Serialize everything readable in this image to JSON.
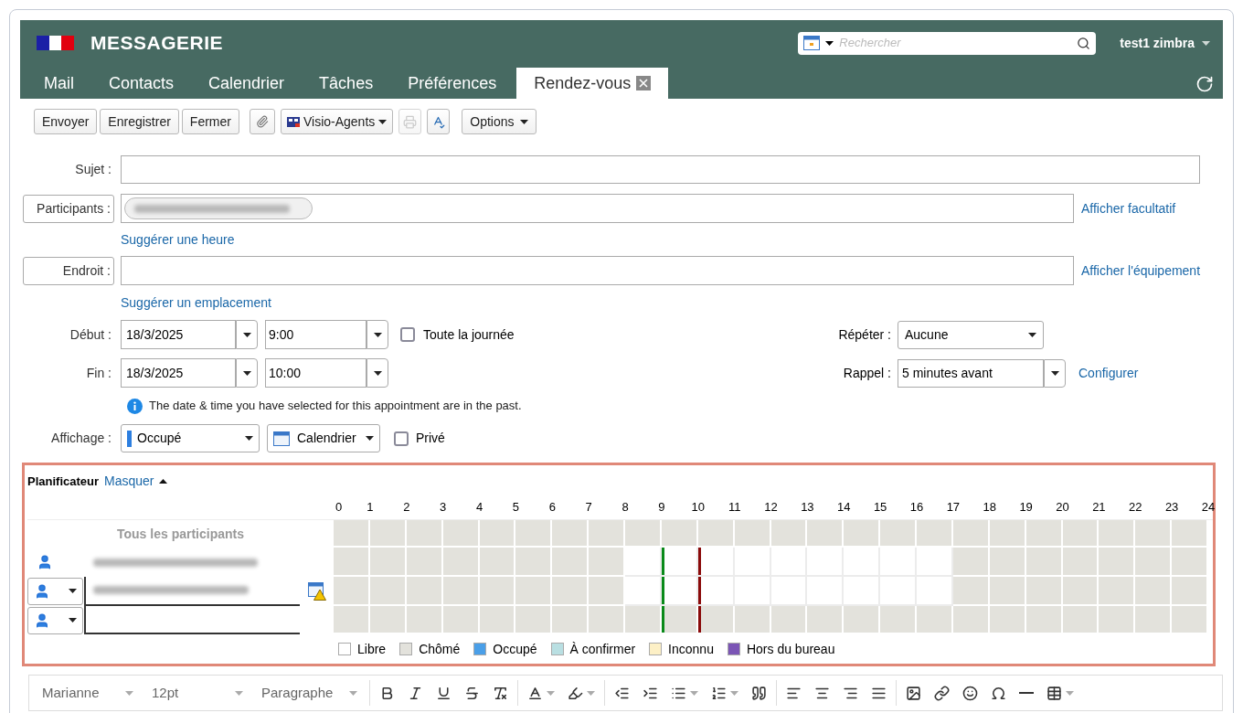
{
  "header": {
    "title": "MESSAGERIE",
    "search": {
      "placeholder": "Rechercher"
    },
    "user": "test1 zimbra"
  },
  "tabs": [
    {
      "label": "Mail",
      "selected": false
    },
    {
      "label": "Contacts",
      "selected": false
    },
    {
      "label": "Calendrier",
      "selected": false
    },
    {
      "label": "Tâches",
      "selected": false
    },
    {
      "label": "Préférences",
      "selected": false
    },
    {
      "label": "Rendez-vous",
      "selected": true
    }
  ],
  "toolbar": [
    {
      "kind": "button",
      "label": "Envoyer",
      "disabled": false
    },
    {
      "kind": "button",
      "label": "Enregistrer",
      "disabled": false
    },
    {
      "kind": "button",
      "label": "Fermer",
      "disabled": false
    },
    {
      "kind": "attach",
      "disabled": false
    },
    {
      "kind": "visio",
      "label": "Visio-Agents",
      "disabled": false
    },
    {
      "kind": "print",
      "disabled": true
    },
    {
      "kind": "spell",
      "disabled": false
    },
    {
      "kind": "menu",
      "label": "Options",
      "disabled": false
    }
  ],
  "form": {
    "subject": {
      "label": "Sujet :"
    },
    "participants": {
      "label": "Participants :",
      "link": "Afficher facultatif",
      "suggest": "Suggérer une heure"
    },
    "location": {
      "label": "Endroit :",
      "link": "Afficher l'équipement",
      "suggest": "Suggérer un emplacement"
    },
    "start": {
      "label": "Début :",
      "date": "18/3/2025",
      "time": "9:00"
    },
    "all_day": {
      "label": "Toute la journée",
      "checked": false
    },
    "end": {
      "label": "Fin :",
      "date": "18/3/2025",
      "time": "10:00"
    },
    "repeat": {
      "label": "Répéter :",
      "value": "Aucune"
    },
    "reminder": {
      "label": "Rappel :",
      "value": "5 minutes avant",
      "link": "Configurer"
    },
    "notice": "The date & time you have selected for this appointment are in the past.",
    "display": {
      "label": "Affichage :",
      "status": "Occupé",
      "calendar": "Calendrier"
    },
    "private": {
      "label": "Privé",
      "checked": false
    }
  },
  "scheduler": {
    "title": "Planificateur",
    "toggle": "Masquer",
    "all_label": "Tous les participants",
    "hours": [
      {
        "label": "0",
        "start_line": false,
        "end_line": false
      },
      {
        "label": "1",
        "start_line": false,
        "end_line": false
      },
      {
        "label": "2",
        "start_line": false,
        "end_line": false
      },
      {
        "label": "3",
        "start_line": false,
        "end_line": false
      },
      {
        "label": "4",
        "start_line": false,
        "end_line": false
      },
      {
        "label": "5",
        "start_line": false,
        "end_line": false
      },
      {
        "label": "6",
        "start_line": false,
        "end_line": false
      },
      {
        "label": "7",
        "start_line": false,
        "end_line": false
      },
      {
        "label": "8",
        "start_line": false,
        "end_line": false
      },
      {
        "label": "9",
        "start_line": true,
        "end_line": false
      },
      {
        "label": "10",
        "start_line": false,
        "end_line": true
      },
      {
        "label": "11",
        "start_line": false,
        "end_line": false
      },
      {
        "label": "12",
        "start_line": false,
        "end_line": false
      },
      {
        "label": "13",
        "start_line": false,
        "end_line": false
      },
      {
        "label": "14",
        "start_line": false,
        "end_line": false
      },
      {
        "label": "15",
        "start_line": false,
        "end_line": false
      },
      {
        "label": "16",
        "start_line": false,
        "end_line": false
      },
      {
        "label": "17",
        "start_line": false,
        "end_line": false
      },
      {
        "label": "18",
        "start_line": false,
        "end_line": false
      },
      {
        "label": "19",
        "start_line": false,
        "end_line": false
      },
      {
        "label": "20",
        "start_line": false,
        "end_line": false
      },
      {
        "label": "21",
        "start_line": false,
        "end_line": false
      },
      {
        "label": "22",
        "start_line": false,
        "end_line": false
      },
      {
        "label": "23",
        "start_line": false,
        "end_line": false
      },
      {
        "label": "24",
        "start_line": false,
        "end_line": false
      }
    ],
    "all_slots": [
      {
        "free": false
      },
      {
        "free": false
      },
      {
        "free": false
      },
      {
        "free": false
      },
      {
        "free": false
      },
      {
        "free": false
      },
      {
        "free": false
      },
      {
        "free": false
      },
      {
        "free": false
      },
      {
        "free": false
      },
      {
        "free": false
      },
      {
        "free": false
      },
      {
        "free": false
      },
      {
        "free": false
      },
      {
        "free": false
      },
      {
        "free": false
      },
      {
        "free": false
      },
      {
        "free": false
      },
      {
        "free": false
      },
      {
        "free": false
      },
      {
        "free": false
      },
      {
        "free": false
      },
      {
        "free": false
      },
      {
        "free": false
      }
    ],
    "rows": [
      {
        "kind": "organizer",
        "warning": false,
        "slots": [
          {
            "free": false
          },
          {
            "free": false
          },
          {
            "free": false
          },
          {
            "free": false
          },
          {
            "free": false
          },
          {
            "free": false
          },
          {
            "free": false
          },
          {
            "free": false
          },
          {
            "free": true
          },
          {
            "free": true
          },
          {
            "free": true
          },
          {
            "free": true
          },
          {
            "free": true
          },
          {
            "free": true
          },
          {
            "free": true
          },
          {
            "free": true
          },
          {
            "free": true
          },
          {
            "free": false
          },
          {
            "free": false
          },
          {
            "free": false
          },
          {
            "free": false
          },
          {
            "free": false
          },
          {
            "free": false
          },
          {
            "free": false
          }
        ]
      },
      {
        "kind": "attendee",
        "warning": true,
        "slots": [
          {
            "free": false
          },
          {
            "free": false
          },
          {
            "free": false
          },
          {
            "free": false
          },
          {
            "free": false
          },
          {
            "free": false
          },
          {
            "free": false
          },
          {
            "free": false
          },
          {
            "free": true
          },
          {
            "free": true
          },
          {
            "free": true
          },
          {
            "free": true
          },
          {
            "free": true
          },
          {
            "free": true
          },
          {
            "free": true
          },
          {
            "free": true
          },
          {
            "free": true
          },
          {
            "free": false
          },
          {
            "free": false
          },
          {
            "free": false
          },
          {
            "free": false
          },
          {
            "free": false
          },
          {
            "free": false
          },
          {
            "free": false
          }
        ]
      },
      {
        "kind": "empty",
        "warning": false,
        "slots": [
          {
            "free": false
          },
          {
            "free": false
          },
          {
            "free": false
          },
          {
            "free": false
          },
          {
            "free": false
          },
          {
            "free": false
          },
          {
            "free": false
          },
          {
            "free": false
          },
          {
            "free": false
          },
          {
            "free": false
          },
          {
            "free": false
          },
          {
            "free": false
          },
          {
            "free": false
          },
          {
            "free": false
          },
          {
            "free": false
          },
          {
            "free": false
          },
          {
            "free": false
          },
          {
            "free": false
          },
          {
            "free": false
          },
          {
            "free": false
          },
          {
            "free": false
          },
          {
            "free": false
          },
          {
            "free": false
          },
          {
            "free": false
          }
        ]
      }
    ],
    "legend": [
      {
        "label": "Libre",
        "color": "#ffffff"
      },
      {
        "label": "Chômé",
        "color": "#e3e2dc"
      },
      {
        "label": "Occupé",
        "color": "#4a9fe8"
      },
      {
        "label": "À confirmer",
        "color": "#b9dfe2"
      },
      {
        "label": "Inconnu",
        "color": "#fdf0c6"
      },
      {
        "label": "Hors du bureau",
        "color": "#7b55b5"
      }
    ]
  },
  "editor": {
    "font": "Marianne",
    "size": "12pt",
    "block": "Paragraphe"
  }
}
